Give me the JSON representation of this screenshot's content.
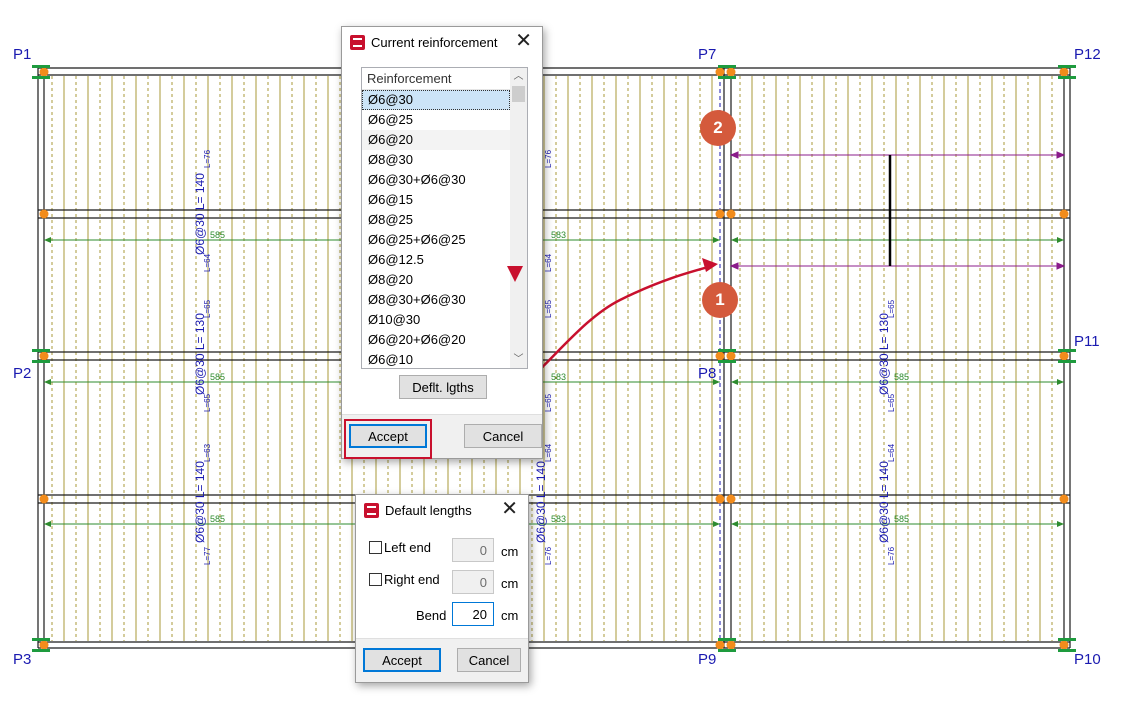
{
  "drawing": {
    "pillar_labels": {
      "p1": "P1",
      "p2": "P2",
      "p3": "P3",
      "p7": "P7",
      "p8": "P8",
      "p9": "P9",
      "p10": "P10",
      "p11": "P11",
      "p12": "P12"
    },
    "rebar_labels": {
      "main_140": "Ø6@30 L= 140",
      "main_130": "Ø6@30 L= 130",
      "len_585": "585",
      "len_583": "583",
      "l76": "L=76",
      "l64": "L=64",
      "l65": "L=65",
      "l63": "L=63",
      "l77": "L=77"
    },
    "colors": {
      "beam": "#1a1a1a",
      "rebar": "#a89a3a",
      "dim": "#2e8b2e",
      "label": "#1a1ab0",
      "node": "#f28c1c",
      "support": "#1e9b3e",
      "arrow": "#c8102e",
      "purple": "#8b1c8b"
    }
  },
  "current_reinforcement_dialog": {
    "title": "Current reinforcement",
    "list_header": "Reinforcement",
    "items": [
      "Ø6@30",
      "Ø6@25",
      "Ø6@20",
      "Ø8@30",
      "Ø6@30+Ø6@30",
      "Ø6@15",
      "Ø8@25",
      "Ø6@25+Ø6@25",
      "Ø6@12.5",
      "Ø8@20",
      "Ø8@30+Ø6@30",
      "Ø10@30",
      "Ø6@20+Ø6@20",
      "Ø6@10"
    ],
    "selected_index": 0,
    "deflt_button": "Deflt. lgths",
    "accept_button": "Accept",
    "cancel_button": "Cancel"
  },
  "default_lengths_dialog": {
    "title": "Default lengths",
    "left_end_label": "Left end",
    "left_end_value": "0",
    "right_end_label": "Right end",
    "right_end_value": "0",
    "bend_label": "Bend",
    "bend_value": "20",
    "unit": "cm",
    "accept_button": "Accept",
    "cancel_button": "Cancel"
  },
  "callouts": {
    "one": "1",
    "two": "2"
  }
}
